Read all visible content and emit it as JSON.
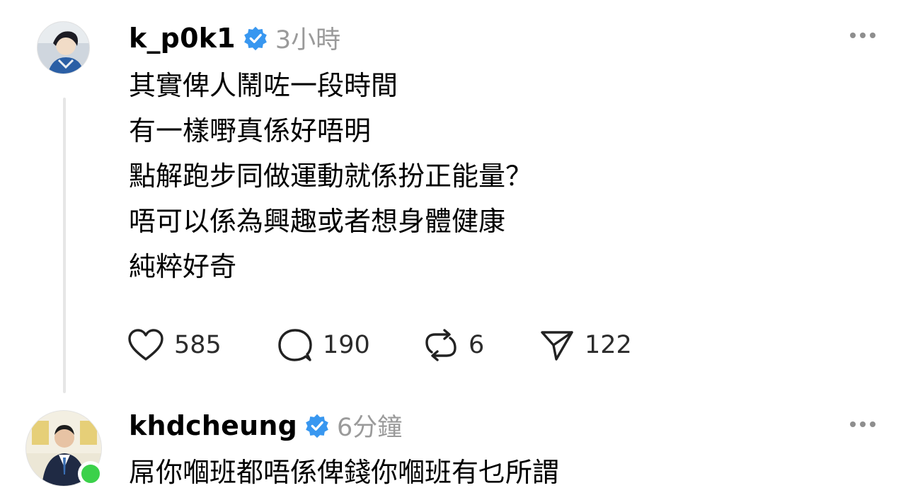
{
  "posts": [
    {
      "username": "k_p0k1",
      "verified": true,
      "time": "3小時",
      "lines": [
        "其實俾人鬧咗一段時間",
        "有一樣嘢真係好唔明",
        "點解跑步同做運動就係扮正能量？",
        "唔可以係為興趣或者想身體健康",
        "純粹好奇"
      ],
      "actions": {
        "likes": "585",
        "replies": "190",
        "reposts": "6",
        "shares": "122"
      }
    },
    {
      "username": "khdcheung",
      "verified": true,
      "time": "6分鐘",
      "online": true,
      "lines": [
        "屌你嗰班都唔係俾錢你嗰班有乜所謂"
      ]
    }
  ],
  "colors": {
    "verified_badge": "#3897f0",
    "online": "#3bd14a",
    "secondary_text": "#9a9a9a",
    "thread_line": "#e6e6e6"
  },
  "icons": {
    "more": "more-horizontal-icon",
    "like": "heart-icon",
    "reply": "comment-bubble-icon",
    "repost": "repost-arrows-icon",
    "share": "send-paper-plane-icon"
  }
}
